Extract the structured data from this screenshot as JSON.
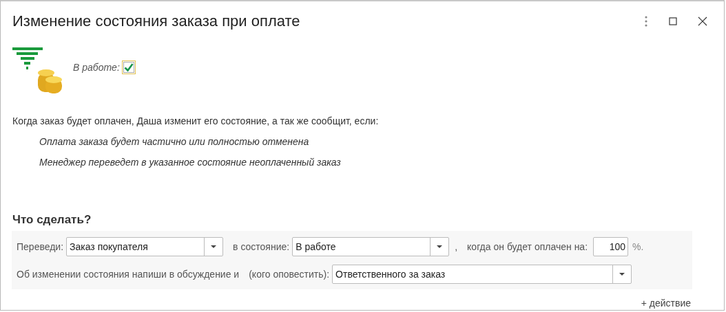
{
  "window": {
    "title": "Изменение состояния заказа при оплате"
  },
  "enabled": {
    "label": "В работе:",
    "checked": true
  },
  "description": {
    "text": "Когда заказ будет оплачен, Даша изменит его состояние, а так же сообщит, если:",
    "items": [
      "Оплата заказа будет частично или полностью отменена",
      "Менеджер переведет в указанное состояние неоплаченный заказ"
    ]
  },
  "actions": {
    "heading": "Что сделать?",
    "row_1": {
      "move_label": "Переведи:",
      "document": "Заказ покупателя",
      "state_label": "в состояние:",
      "state": "В работе",
      "comma": ",",
      "paid_label": "когда он будет оплачен на:",
      "percent": "100",
      "percent_sign": "%."
    },
    "row_2": {
      "notify_label": "Об изменении состояния напиши в обсуждение и",
      "whom_label": "(кого оповестить):",
      "whom": "Ответственного за заказ"
    },
    "add_action": "+ действие"
  }
}
